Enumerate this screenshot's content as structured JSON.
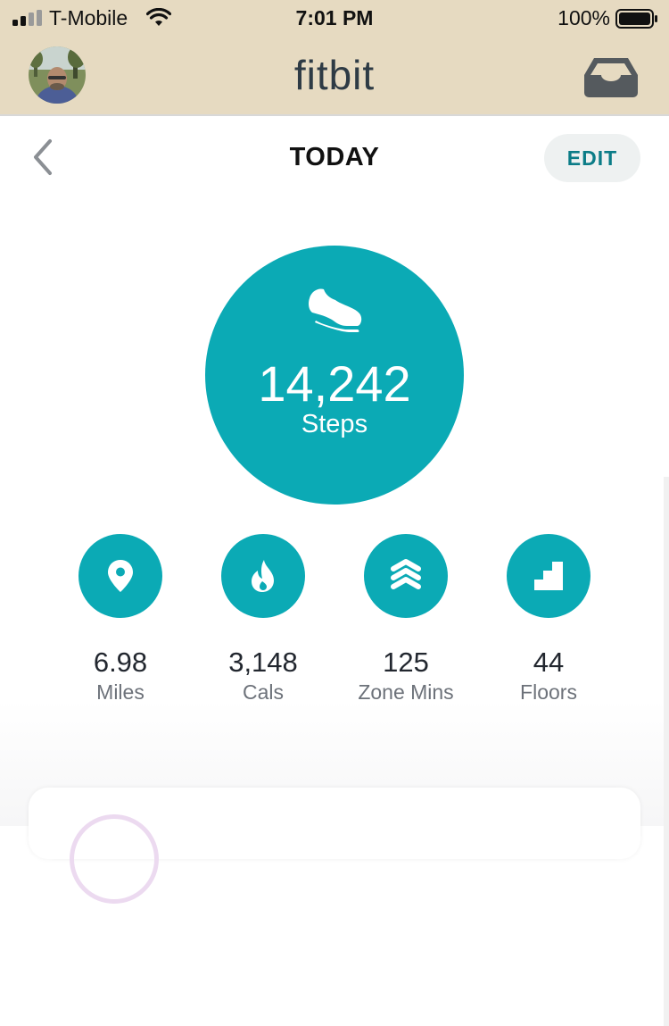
{
  "status_bar": {
    "carrier": "T-Mobile",
    "time": "7:01 PM",
    "battery_percent": "100%",
    "battery_level": 1.0,
    "signal_bars": 2
  },
  "header": {
    "logo_text": "fitbit",
    "avatar_icon": "profile-photo",
    "inbox_icon": "inbox-icon",
    "background_color": "#e6dac1"
  },
  "nav": {
    "back_icon": "chevron-left-icon",
    "title": "TODAY",
    "edit_label": "EDIT"
  },
  "steps": {
    "icon": "shoe-icon",
    "value": "14,242",
    "label": "Steps",
    "accent_color": "#0baab5"
  },
  "stats": [
    {
      "icon": "location-pin-icon",
      "value": "6.98",
      "label": "Miles"
    },
    {
      "icon": "flame-icon",
      "value": "3,148",
      "label": "Cals"
    },
    {
      "icon": "zone-chevrons-icon",
      "value": "125",
      "label": "Zone Mins"
    },
    {
      "icon": "stairs-icon",
      "value": "44",
      "label": "Floors"
    }
  ]
}
